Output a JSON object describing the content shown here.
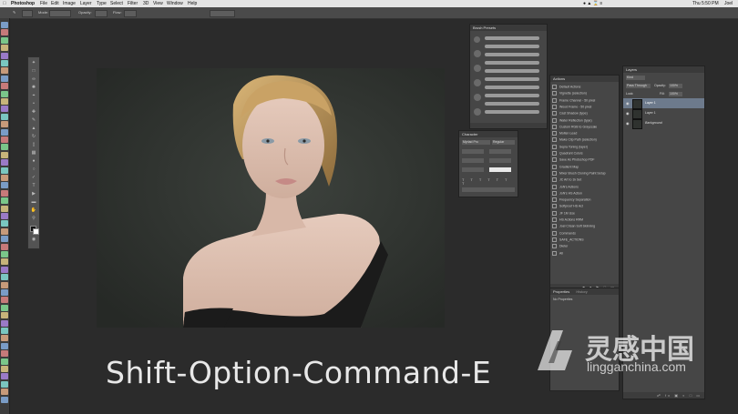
{
  "menubar": {
    "app": "Photoshop",
    "items": [
      "File",
      "Edit",
      "Image",
      "Layer",
      "Type",
      "Select",
      "Filter",
      "3D",
      "View",
      "Window",
      "Help"
    ],
    "clock": "Thu 5:50 PM",
    "user": "Joel"
  },
  "options_bar": {
    "mode_label": "Mode:",
    "opacity_label": "Opacity:",
    "flow_label": "Flow:"
  },
  "panels": {
    "brush_presets": {
      "title": "Brush Presets"
    },
    "actions": {
      "title": "Actions",
      "items": [
        "Default Actions",
        "Vignette (selection)",
        "Frame Channel - 50 pixel",
        "Wood Frame - 50 pixel",
        "Cast Shadow (type)",
        "Water Reflection (type)",
        "Custom RGB to Grayscale",
        "Molten Lead",
        "Make Clip Path (selection)",
        "Sepia Toning (layer)",
        "Quadrant Colors",
        "Save As Photoshop PDF",
        "Gradient Map",
        "Mixer Brush Cloning Paint Setup",
        "JC Art to 1k Set",
        "JoN's Actions",
        "JoN's HS Action",
        "Frequency Separation",
        "Softproof HS Act",
        "JF 1M Use",
        "HS Actions RRM",
        "Joel Crisan Soft Skinning",
        "Commands",
        "SAFE_ACTIONS",
        "Dieter",
        "All"
      ]
    },
    "character": {
      "title": "Character",
      "font": "Myriad Pro",
      "style": "Regular"
    },
    "layers": {
      "title": "Layers",
      "kind": "Kind",
      "mode": "Pass Through",
      "opacity_label": "Opacity:",
      "opacity": "100%",
      "fill_label": "Fill:",
      "fill": "100%",
      "lock_label": "Lock:",
      "items": [
        "Layer 1",
        "Layer 1",
        "Background"
      ]
    },
    "properties": {
      "title": "Properties",
      "tab2": "History",
      "body": "No Properties"
    }
  },
  "caption": "Shift-Option-Command-E",
  "watermark": {
    "chinese": "灵感中国",
    "latin": "lingganchina.com"
  },
  "colors": {
    "app_bg": "#2b2b2b",
    "panel": "#464646",
    "canvas_bg": "#2e312e",
    "caption": "#e8e8e8"
  }
}
